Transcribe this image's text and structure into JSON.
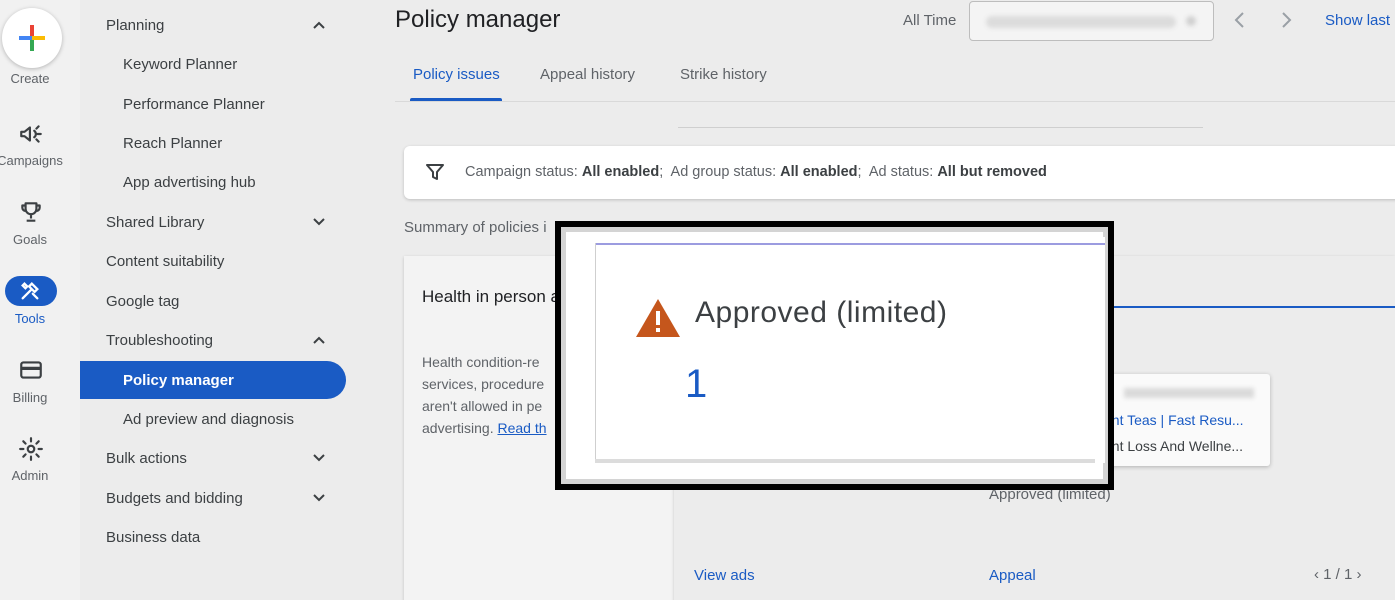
{
  "rail": {
    "create_label": "Create",
    "items": [
      {
        "label": "Campaigns",
        "icon": "megaphone-icon"
      },
      {
        "label": "Goals",
        "icon": "trophy-icon"
      },
      {
        "label": "Tools",
        "icon": "tools-icon"
      },
      {
        "label": "Billing",
        "icon": "credit-card-icon"
      },
      {
        "label": "Admin",
        "icon": "gear-icon"
      }
    ]
  },
  "sidebar": {
    "items": [
      {
        "label": "Planning",
        "level": 0,
        "chevron": "up"
      },
      {
        "label": "Keyword Planner",
        "level": 1
      },
      {
        "label": "Performance Planner",
        "level": 1
      },
      {
        "label": "Reach Planner",
        "level": 1
      },
      {
        "label": "App advertising hub",
        "level": 1
      },
      {
        "label": "Shared Library",
        "level": 0,
        "chevron": "down"
      },
      {
        "label": "Content suitability",
        "level": 0
      },
      {
        "label": "Google tag",
        "level": 0
      },
      {
        "label": "Troubleshooting",
        "level": 0,
        "chevron": "up"
      },
      {
        "label": "Policy manager",
        "level": 1,
        "active": true
      },
      {
        "label": "Ad preview and diagnosis",
        "level": 1
      },
      {
        "label": "Bulk actions",
        "level": 0,
        "chevron": "down"
      },
      {
        "label": "Budgets and bidding",
        "level": 0,
        "chevron": "down"
      },
      {
        "label": "Business data",
        "level": 0
      }
    ]
  },
  "header": {
    "title": "Policy manager",
    "date_range_label": "All Time",
    "show_last": "Show last"
  },
  "tabs": [
    {
      "label": "Policy issues",
      "active": true
    },
    {
      "label": "Appeal history"
    },
    {
      "label": "Strike history"
    }
  ],
  "filter": {
    "campaign_status_label": "Campaign status:",
    "campaign_status_value": "All enabled",
    "ad_group_status_label": "Ad group status:",
    "ad_group_status_value": "All enabled",
    "ad_status_label": "Ad status:",
    "ad_status_value": "All but removed"
  },
  "summary_text": "Summary of policies i",
  "policy_card": {
    "title": "Health in person advertising",
    "description": "Health condition-re services, procedure aren't allowed in pe advertising.",
    "read_more": "Read th"
  },
  "ad_preview": {
    "line1": "ant Teas | Fast Resu...",
    "line2": "ght Loss And Wellne..."
  },
  "status_text": "Approved (limited)",
  "view_ads": "View ads",
  "appeal": "Appeal",
  "pager": "1 / 1",
  "zoom": {
    "title": "Approved (limited)",
    "count": "1"
  },
  "colors": {
    "accent": "#1a5bc4",
    "warning": "#c5561c"
  }
}
